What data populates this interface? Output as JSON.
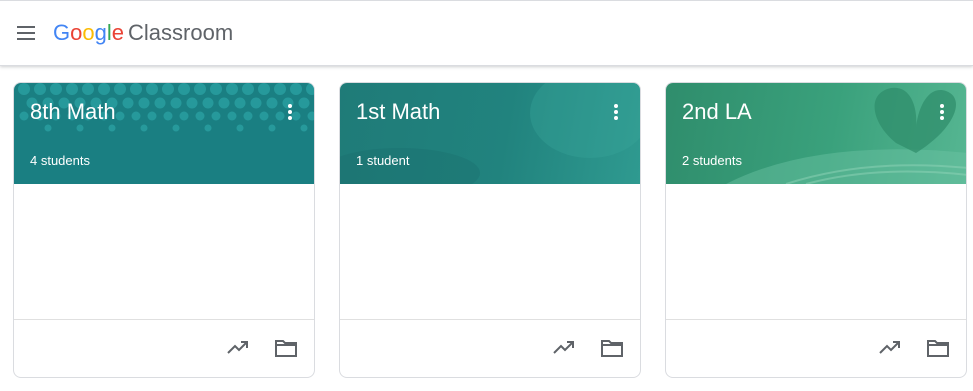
{
  "header": {
    "brand_google": [
      "G",
      "o",
      "o",
      "g",
      "l",
      "e"
    ],
    "product": "Classroom",
    "menu_icon": "hamburger-menu-icon"
  },
  "classes": [
    {
      "name": "8th Math",
      "students": "4 students",
      "theme": "#1a7f82"
    },
    {
      "name": "1st Math",
      "students": "1 student",
      "theme": "#21837e"
    },
    {
      "name": "2nd LA",
      "students": "2 students",
      "theme": "#3aa17c"
    }
  ],
  "icons": {
    "more": "more-vert-icon",
    "trending": "trending-up-icon",
    "folder": "folder-icon"
  }
}
